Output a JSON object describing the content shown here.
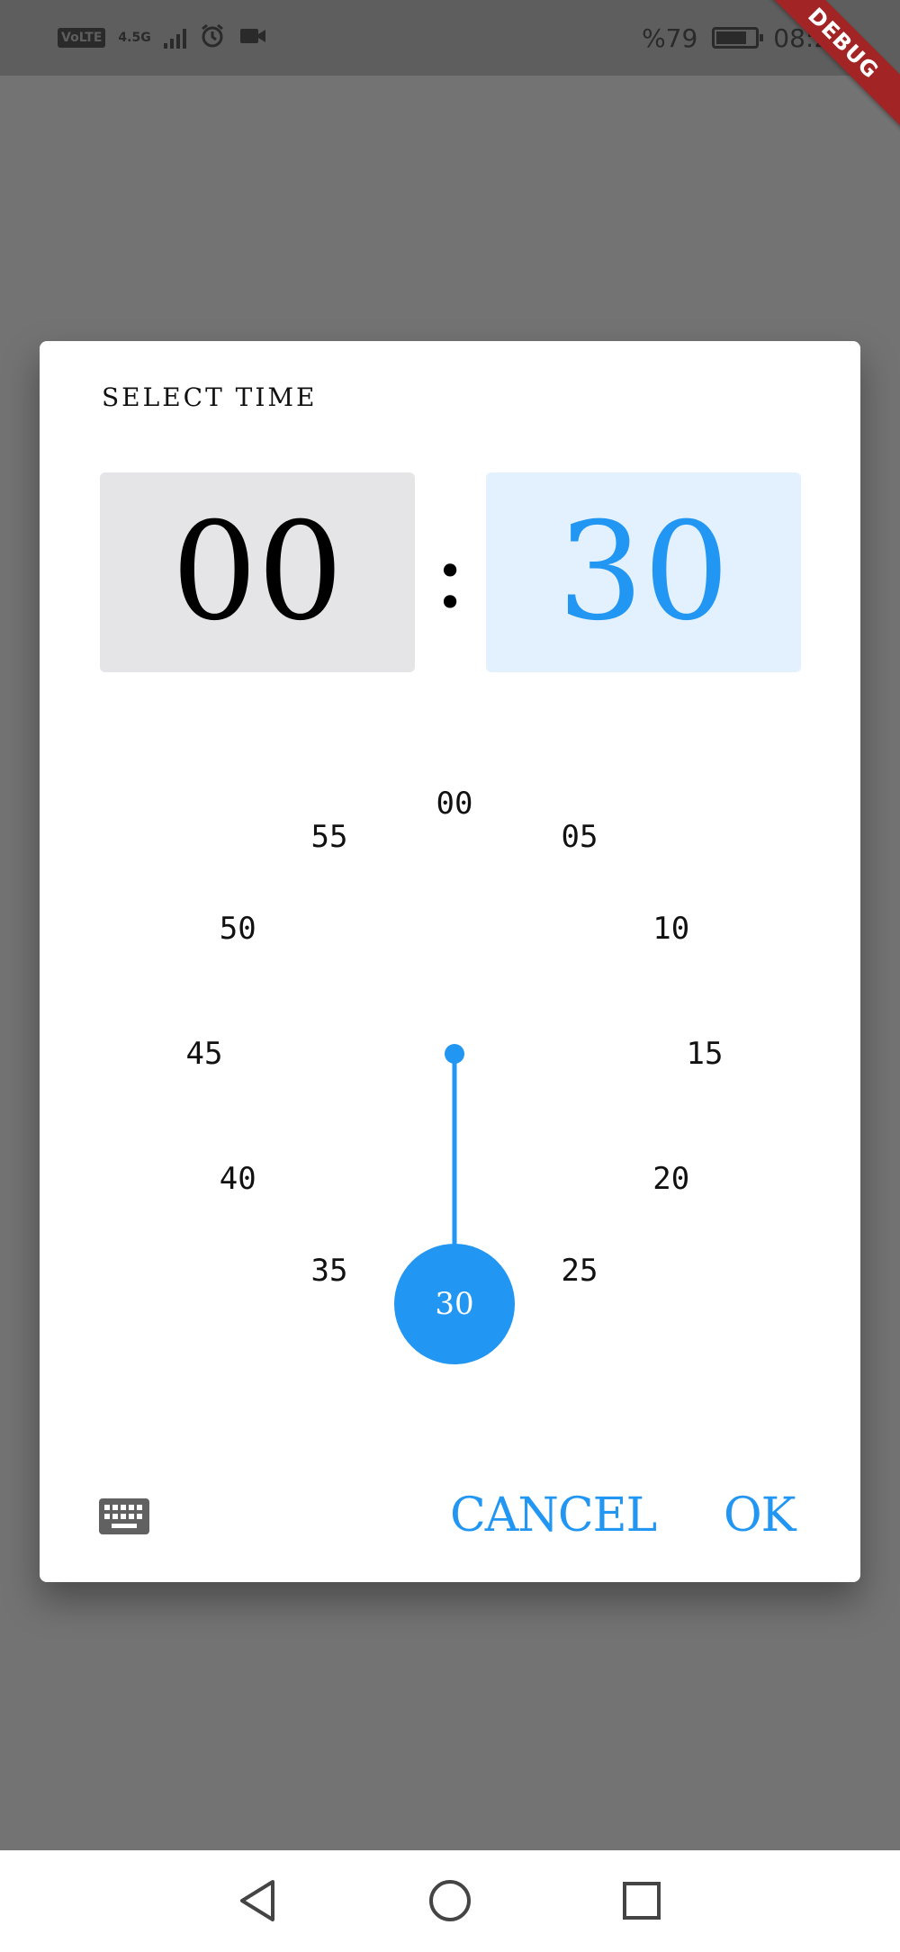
{
  "status_bar": {
    "volte_label": "VoLTE",
    "network_label": "4.5G",
    "battery_text": "%79",
    "time_text": "08:23",
    "battery_level": 0.79
  },
  "debug_banner": "DEBUG",
  "dialog": {
    "title": "SELECT TIME",
    "hour": "00",
    "separator": ":",
    "minute": "30",
    "dial_numbers": [
      "00",
      "05",
      "10",
      "15",
      "20",
      "25",
      "30",
      "35",
      "40",
      "45",
      "50",
      "55"
    ],
    "selected_value": "30",
    "cancel_label": "CANCEL",
    "ok_label": "OK"
  },
  "colors": {
    "accent": "#2196f3",
    "hour_bg": "#e5e4e6",
    "minute_bg": "#e3f0fd",
    "scrim": "#737373",
    "debug_red": "#a32424"
  },
  "icons": {
    "keyboard": "keyboard-icon",
    "alarm": "alarm-icon",
    "video": "video-camera-icon",
    "nav_back": "triangle-back-icon",
    "nav_home": "circle-home-icon",
    "nav_recents": "square-recents-icon"
  }
}
